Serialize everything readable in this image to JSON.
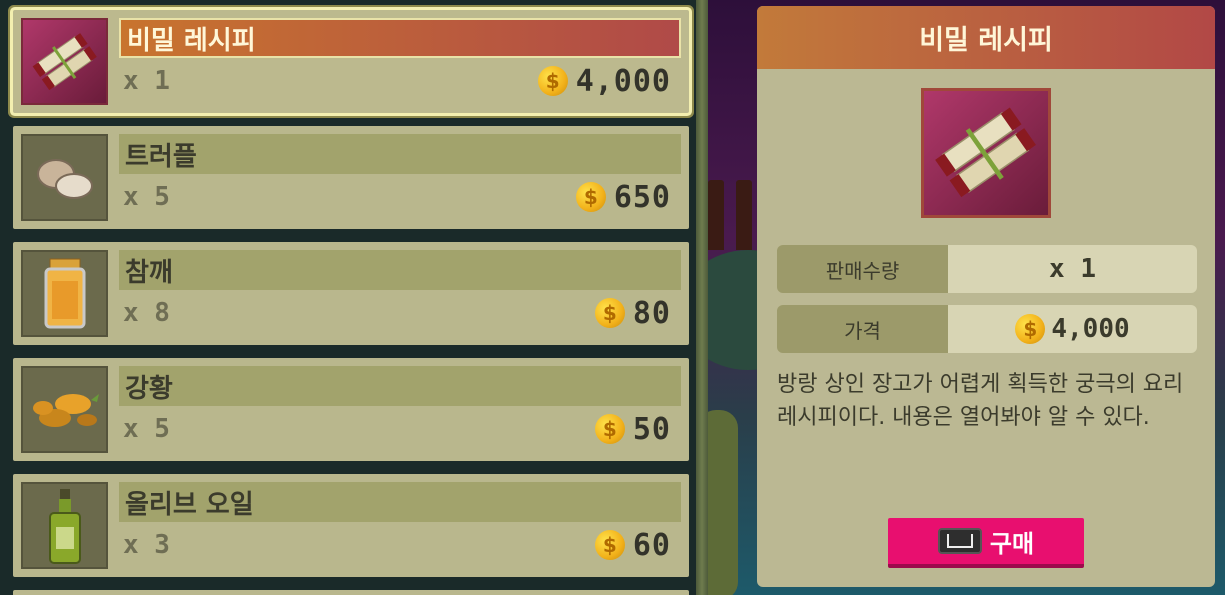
{
  "shop": {
    "items": [
      {
        "name": "비밀 레시피",
        "qty": "x 1",
        "price": "4,000",
        "icon": "recipe-scroll-icon",
        "selected": true
      },
      {
        "name": "트러플",
        "qty": "x 5",
        "price": "650",
        "icon": "truffle-icon",
        "selected": false
      },
      {
        "name": "참깨",
        "qty": "x 8",
        "price": "80",
        "icon": "sesame-jar-icon",
        "selected": false
      },
      {
        "name": "강황",
        "qty": "x 5",
        "price": "50",
        "icon": "turmeric-icon",
        "selected": false
      },
      {
        "name": "올리브 오일",
        "qty": "x 3",
        "price": "60",
        "icon": "olive-oil-bottle-icon",
        "selected": false
      }
    ],
    "currency_symbol": "$"
  },
  "detail": {
    "title": "비밀 레시피",
    "icon": "recipe-scroll-icon",
    "sale_qty_label": "판매수량",
    "sale_qty_value": "x 1",
    "price_label": "가격",
    "price_value": "4,000",
    "description": "방랑 상인 장고가 어렵게 획득한 궁극의 요리 레시피이다. 내용은 열어봐야 알 수 있다.",
    "buy_label": "구매",
    "buy_key_icon": "spacebar-key-icon"
  },
  "colors": {
    "selected_header": "#c27a3a",
    "buy_button": "#e80f6f",
    "coin": "#f2b11a"
  }
}
